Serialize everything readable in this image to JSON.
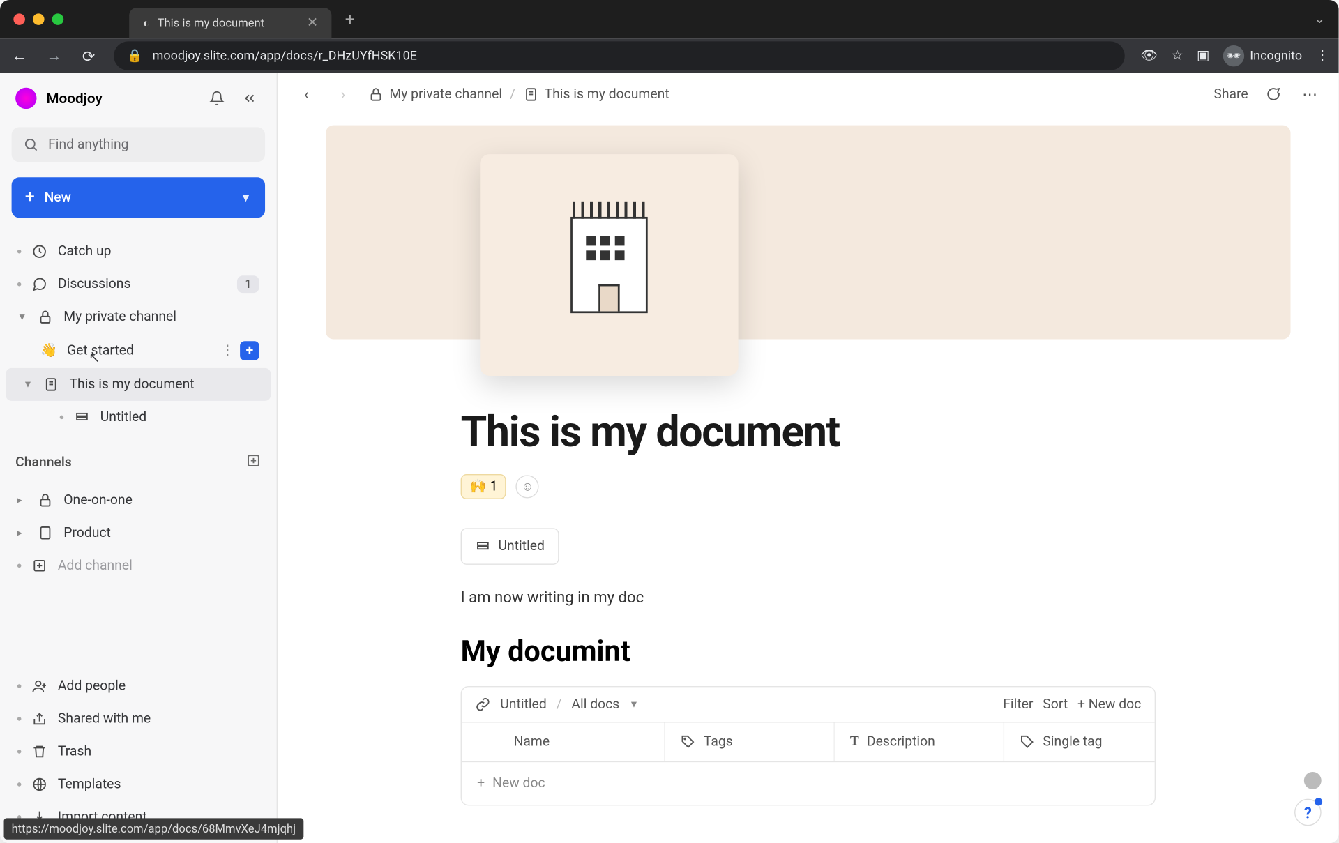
{
  "browser": {
    "tab_title": "This is my document",
    "url": "moodjoy.slite.com/app/docs/r_DHzUYfHSK10E",
    "incognito_label": "Incognito",
    "link_preview": "https://moodjoy.slite.com/app/docs/68MmvXeJ4mjqhj"
  },
  "workspace": {
    "name": "Moodjoy"
  },
  "search": {
    "placeholder": "Find anything"
  },
  "new_button": {
    "label": "New"
  },
  "sidebar": {
    "top": [
      {
        "label": "Catch up",
        "icon": "clock"
      },
      {
        "label": "Discussions",
        "icon": "chat",
        "badge": "1"
      }
    ],
    "private": {
      "label": "My private channel",
      "children": [
        {
          "label": "Get started",
          "emoji": "👋",
          "hover": true
        },
        {
          "label": "This is my document",
          "icon": "doc",
          "active": true,
          "children": [
            {
              "label": "Untitled",
              "icon": "stack"
            }
          ]
        }
      ]
    },
    "channels_label": "Channels",
    "channels": [
      {
        "label": "One-on-one",
        "icon": "lock"
      },
      {
        "label": "Product",
        "icon": "doc"
      }
    ],
    "add_channel": "Add channel",
    "footer": [
      {
        "label": "Add people",
        "icon": "user-plus"
      },
      {
        "label": "Shared with me",
        "icon": "share"
      },
      {
        "label": "Trash",
        "icon": "trash"
      },
      {
        "label": "Templates",
        "icon": "globe"
      },
      {
        "label": "Import content",
        "icon": "download"
      }
    ]
  },
  "breadcrumb": {
    "items": [
      {
        "label": "My private channel",
        "icon": "lock"
      },
      {
        "label": "This is my document",
        "icon": "doc"
      }
    ],
    "share": "Share"
  },
  "doc": {
    "title": "This is my document",
    "reaction": {
      "emoji": "🙌",
      "count": "1"
    },
    "subpage_chip": "Untitled",
    "body": "I am now writing in my doc",
    "h2": "My documint",
    "db": {
      "source": "Untitled",
      "view": "All docs",
      "filter": "Filter",
      "sort": "Sort",
      "newdoc": "New doc",
      "cols": [
        "Name",
        "Tags",
        "Description",
        "Single tag"
      ],
      "add_row": "New doc"
    }
  }
}
